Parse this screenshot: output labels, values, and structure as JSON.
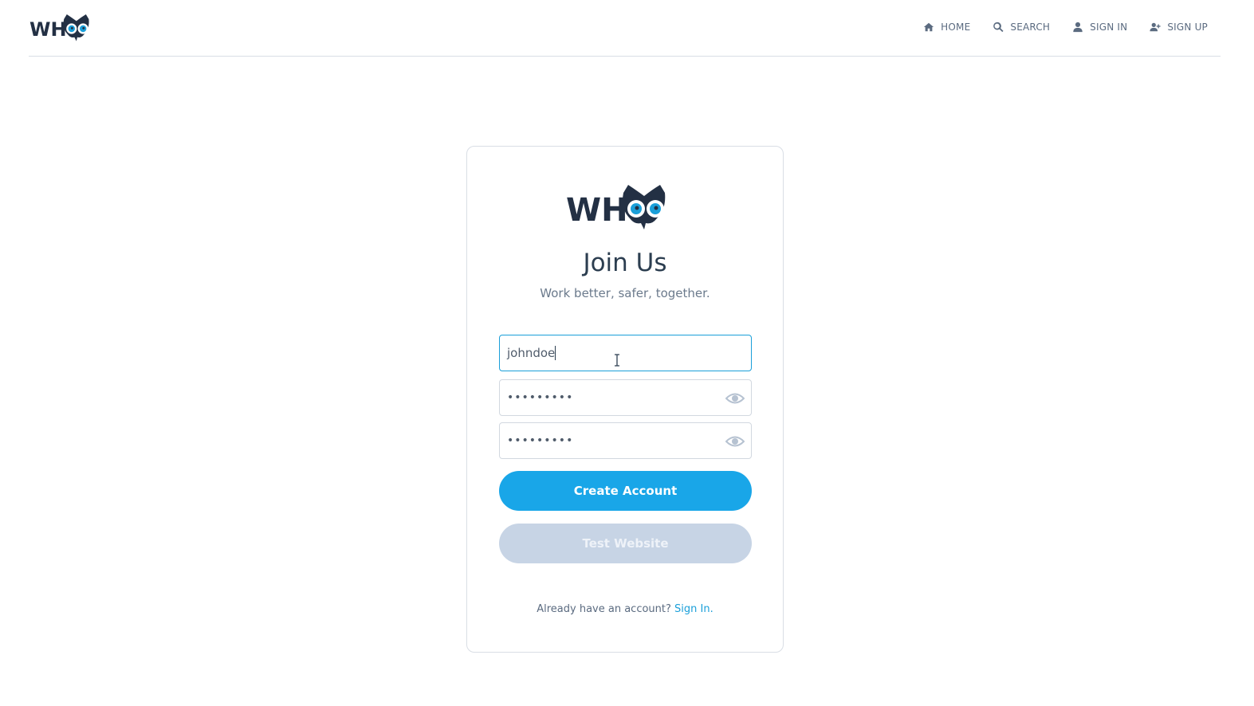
{
  "brand": {
    "logo_text": "WHOO",
    "accent": "#19a6e8",
    "eye_color": "#1a9fd9",
    "dark": "#2c3e50"
  },
  "nav": {
    "items": [
      {
        "label": "HOME",
        "icon": "home-icon"
      },
      {
        "label": "SEARCH",
        "icon": "search-icon"
      },
      {
        "label": "SIGN IN",
        "icon": "user-icon"
      },
      {
        "label": "SIGN UP",
        "icon": "user-plus-icon"
      }
    ]
  },
  "form": {
    "title": "Join Us",
    "subtitle": "Work better, safer, together.",
    "username_value": "johndoe",
    "password_mask": "•••••••••",
    "confirm_mask": "•••••••••",
    "create_label": "Create Account",
    "test_label": "Test Website",
    "footer_text": "Already have an account?",
    "footer_link": "Sign In."
  }
}
